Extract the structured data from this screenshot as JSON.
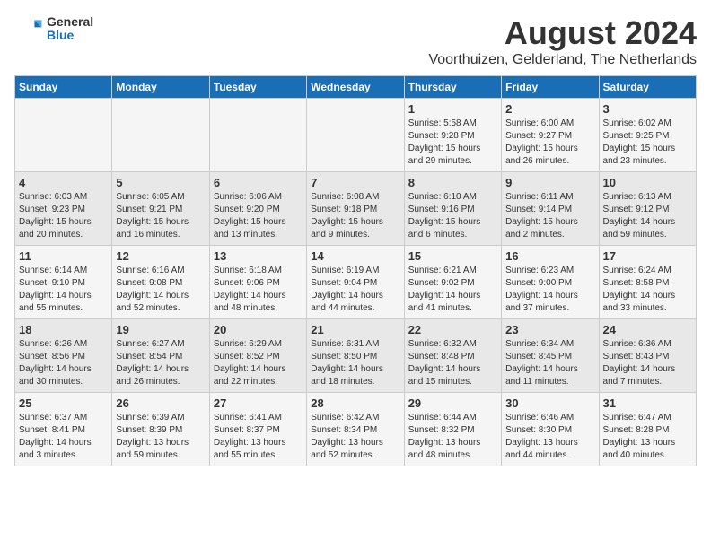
{
  "logo": {
    "general": "General",
    "blue": "Blue"
  },
  "header": {
    "month": "August 2024",
    "location": "Voorthuizen, Gelderland, The Netherlands"
  },
  "weekdays": [
    "Sunday",
    "Monday",
    "Tuesday",
    "Wednesday",
    "Thursday",
    "Friday",
    "Saturday"
  ],
  "weeks": [
    [
      {
        "day": "",
        "info": ""
      },
      {
        "day": "",
        "info": ""
      },
      {
        "day": "",
        "info": ""
      },
      {
        "day": "",
        "info": ""
      },
      {
        "day": "1",
        "info": "Sunrise: 5:58 AM\nSunset: 9:28 PM\nDaylight: 15 hours\nand 29 minutes."
      },
      {
        "day": "2",
        "info": "Sunrise: 6:00 AM\nSunset: 9:27 PM\nDaylight: 15 hours\nand 26 minutes."
      },
      {
        "day": "3",
        "info": "Sunrise: 6:02 AM\nSunset: 9:25 PM\nDaylight: 15 hours\nand 23 minutes."
      }
    ],
    [
      {
        "day": "4",
        "info": "Sunrise: 6:03 AM\nSunset: 9:23 PM\nDaylight: 15 hours\nand 20 minutes."
      },
      {
        "day": "5",
        "info": "Sunrise: 6:05 AM\nSunset: 9:21 PM\nDaylight: 15 hours\nand 16 minutes."
      },
      {
        "day": "6",
        "info": "Sunrise: 6:06 AM\nSunset: 9:20 PM\nDaylight: 15 hours\nand 13 minutes."
      },
      {
        "day": "7",
        "info": "Sunrise: 6:08 AM\nSunset: 9:18 PM\nDaylight: 15 hours\nand 9 minutes."
      },
      {
        "day": "8",
        "info": "Sunrise: 6:10 AM\nSunset: 9:16 PM\nDaylight: 15 hours\nand 6 minutes."
      },
      {
        "day": "9",
        "info": "Sunrise: 6:11 AM\nSunset: 9:14 PM\nDaylight: 15 hours\nand 2 minutes."
      },
      {
        "day": "10",
        "info": "Sunrise: 6:13 AM\nSunset: 9:12 PM\nDaylight: 14 hours\nand 59 minutes."
      }
    ],
    [
      {
        "day": "11",
        "info": "Sunrise: 6:14 AM\nSunset: 9:10 PM\nDaylight: 14 hours\nand 55 minutes."
      },
      {
        "day": "12",
        "info": "Sunrise: 6:16 AM\nSunset: 9:08 PM\nDaylight: 14 hours\nand 52 minutes."
      },
      {
        "day": "13",
        "info": "Sunrise: 6:18 AM\nSunset: 9:06 PM\nDaylight: 14 hours\nand 48 minutes."
      },
      {
        "day": "14",
        "info": "Sunrise: 6:19 AM\nSunset: 9:04 PM\nDaylight: 14 hours\nand 44 minutes."
      },
      {
        "day": "15",
        "info": "Sunrise: 6:21 AM\nSunset: 9:02 PM\nDaylight: 14 hours\nand 41 minutes."
      },
      {
        "day": "16",
        "info": "Sunrise: 6:23 AM\nSunset: 9:00 PM\nDaylight: 14 hours\nand 37 minutes."
      },
      {
        "day": "17",
        "info": "Sunrise: 6:24 AM\nSunset: 8:58 PM\nDaylight: 14 hours\nand 33 minutes."
      }
    ],
    [
      {
        "day": "18",
        "info": "Sunrise: 6:26 AM\nSunset: 8:56 PM\nDaylight: 14 hours\nand 30 minutes."
      },
      {
        "day": "19",
        "info": "Sunrise: 6:27 AM\nSunset: 8:54 PM\nDaylight: 14 hours\nand 26 minutes."
      },
      {
        "day": "20",
        "info": "Sunrise: 6:29 AM\nSunset: 8:52 PM\nDaylight: 14 hours\nand 22 minutes."
      },
      {
        "day": "21",
        "info": "Sunrise: 6:31 AM\nSunset: 8:50 PM\nDaylight: 14 hours\nand 18 minutes."
      },
      {
        "day": "22",
        "info": "Sunrise: 6:32 AM\nSunset: 8:48 PM\nDaylight: 14 hours\nand 15 minutes."
      },
      {
        "day": "23",
        "info": "Sunrise: 6:34 AM\nSunset: 8:45 PM\nDaylight: 14 hours\nand 11 minutes."
      },
      {
        "day": "24",
        "info": "Sunrise: 6:36 AM\nSunset: 8:43 PM\nDaylight: 14 hours\nand 7 minutes."
      }
    ],
    [
      {
        "day": "25",
        "info": "Sunrise: 6:37 AM\nSunset: 8:41 PM\nDaylight: 14 hours\nand 3 minutes."
      },
      {
        "day": "26",
        "info": "Sunrise: 6:39 AM\nSunset: 8:39 PM\nDaylight: 13 hours\nand 59 minutes."
      },
      {
        "day": "27",
        "info": "Sunrise: 6:41 AM\nSunset: 8:37 PM\nDaylight: 13 hours\nand 55 minutes."
      },
      {
        "day": "28",
        "info": "Sunrise: 6:42 AM\nSunset: 8:34 PM\nDaylight: 13 hours\nand 52 minutes."
      },
      {
        "day": "29",
        "info": "Sunrise: 6:44 AM\nSunset: 8:32 PM\nDaylight: 13 hours\nand 48 minutes."
      },
      {
        "day": "30",
        "info": "Sunrise: 6:46 AM\nSunset: 8:30 PM\nDaylight: 13 hours\nand 44 minutes."
      },
      {
        "day": "31",
        "info": "Sunrise: 6:47 AM\nSunset: 8:28 PM\nDaylight: 13 hours\nand 40 minutes."
      }
    ]
  ]
}
